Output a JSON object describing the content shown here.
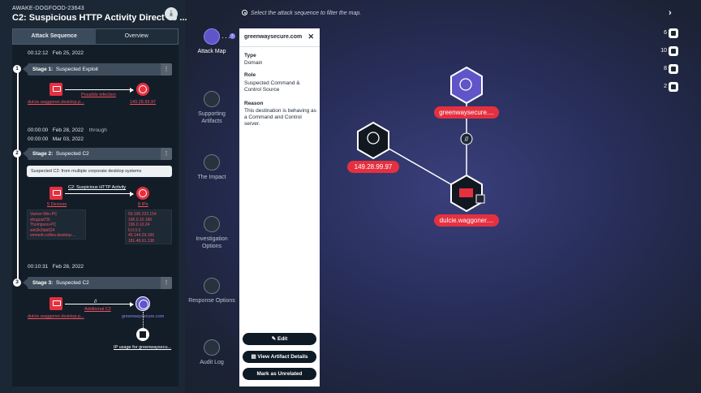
{
  "header": {
    "case_id": "AWAKE-DOGFOOD-23643",
    "title": "C2: Suspicious HTTP Activity Direct To ...",
    "download_icon": "download-icon"
  },
  "tabs": [
    {
      "label": "Attack Sequence",
      "active": true
    },
    {
      "label": "Overview",
      "active": false
    }
  ],
  "timeline": {
    "start_time": "00:12:12",
    "start_date": "Feb 25, 2022",
    "stage1": {
      "num": "1",
      "prefix": "Stage 1:",
      "name": "Suspected Exploit",
      "src_label": "dulcie.waggoner.desktop.p...",
      "edge_label": "Possible infection",
      "dst_label": "149.28.99.97"
    },
    "stage2_start_time": "00:00:00",
    "stage2_start_date": "Feb 28, 2022",
    "through": "through",
    "stage2_end_time": "00:00:00",
    "stage2_end_date": "Mar 03, 2022",
    "stage2": {
      "num": "2",
      "prefix": "Stage 2:",
      "name": "Suspected C2",
      "summary": "Suspected C2: from multiple corporate desktop systems",
      "src_label": "5 Devices",
      "edge_label": "C2: Suspicious HTTP Activity",
      "dst_label": "8 IPs",
      "devices": [
        "Varner-Win-PC",
        "shugout70i",
        "Thompson-PC",
        "win2k3lab024",
        "emmett.collins.desktop-..."
      ],
      "ips": [
        "59.195.223.154",
        "196.0.10.180",
        "196.0.10.24",
        "0.0.0.0",
        "45.144.29.185",
        "181.48.61.138"
      ]
    },
    "stage3_time": "00:10:31",
    "stage3_date": "Feb 28, 2022",
    "stage3": {
      "num": "3",
      "prefix": "Stage 3:",
      "name": "Suspected C2",
      "src_label": "dulcie.waggoner.desktop.p...",
      "edge_label": "Additional C2",
      "dst_label": "greenwaysecure.com",
      "sub_label": "IP usage for greenwaysecu..."
    }
  },
  "nav": [
    {
      "label": "Attack Map",
      "active": true
    },
    {
      "label": "Supporting Artifacts",
      "active": false
    },
    {
      "label": "The Impact",
      "active": false
    },
    {
      "label": "Investigation Options",
      "active": false
    },
    {
      "label": "Response Options",
      "active": false
    },
    {
      "label": "Audit Log",
      "active": false
    }
  ],
  "detail": {
    "title": "greenwaysecure.com",
    "close": "✕",
    "type_label": "Type",
    "type_value": "Domain",
    "role_label": "Role",
    "role_value": "Suspected Command & Control Source",
    "reason_label": "Reason",
    "reason_value": "This destination is behaving as a Command and Control server.",
    "edit_label": "Edit",
    "view_label": "View Artifact Details",
    "unrelated_label": "Mark as Unrelated"
  },
  "map": {
    "hint": "Select the attack sequence to filter the map.",
    "nodes": {
      "domain": "greenwaysecure....",
      "ip": "149.28.99.97",
      "device": "dulcie.waggoner...."
    },
    "counts": [
      "6",
      "10",
      "8",
      "2"
    ]
  },
  "colors": {
    "accent": "#5f55c9",
    "alert": "#e53040",
    "panel": "#131d28"
  }
}
